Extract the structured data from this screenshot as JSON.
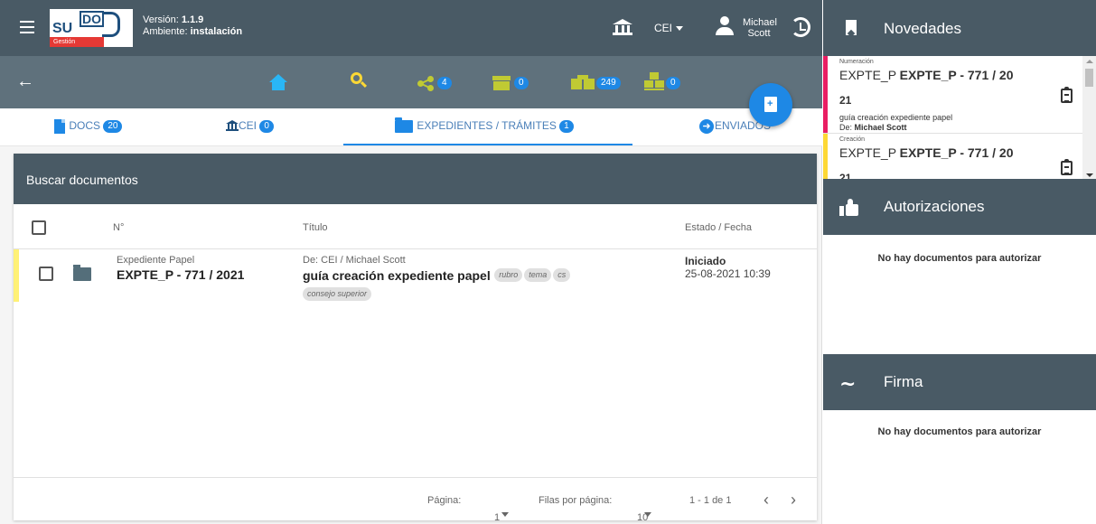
{
  "header": {
    "version_label": "Versión:",
    "version_value": "1.1.9",
    "env_label": "Ambiente:",
    "env_value": "instalación",
    "org_selector": "CEI",
    "user_first": "Michael",
    "user_last": "Scott",
    "logo": {
      "text_su": "SU",
      "text_do": "DO",
      "text_gestion": "Gestión"
    }
  },
  "toolbar": {
    "share_count": "4",
    "archive_count": "0",
    "boxes_count": "249",
    "pallet_count": "0"
  },
  "tabs": [
    {
      "label": "DOCS",
      "count": "20"
    },
    {
      "label": "CEI",
      "count": "0"
    },
    {
      "label": "EXPEDIENTES / TRÁMITES",
      "count": "1"
    },
    {
      "label": "ENVIADOS"
    }
  ],
  "search": {
    "title": "Buscar documentos"
  },
  "table": {
    "columns": [
      "N°",
      "Título",
      "Estado / Fecha"
    ],
    "rows": [
      {
        "type": "Expediente Papel",
        "number": "EXPTE_P - 771 / 2021",
        "from": "De: CEI / Michael Scott",
        "title": "guía creación expediente papel",
        "tags": [
          "rubro",
          "tema",
          "cs",
          "consejo superior"
        ],
        "status": "Iniciado",
        "date": "25-08-2021 10:39"
      }
    ]
  },
  "pager": {
    "page_label": "Página:",
    "page_value": "1",
    "rows_label": "Filas por página:",
    "rows_value": "10",
    "range": "1 - 1 de 1",
    "prev": "‹",
    "next": "›"
  },
  "novedades": {
    "title": "Novedades",
    "items": [
      {
        "kind": "Numeración",
        "prefix": "EXPTE_P",
        "number_line1": "EXPTE_P - 771 / 20",
        "number_line2": "21",
        "desc": "guía creación expediente papel",
        "from_label": "De:",
        "from_value": "Michael Scott",
        "color": "#e91e63"
      },
      {
        "kind": "Creación",
        "prefix": "EXPTE_P",
        "number_line1": "EXPTE_P - 771 / 20",
        "number_line2": "21",
        "color": "#fdd835"
      }
    ]
  },
  "autorizaciones": {
    "title": "Autorizaciones",
    "empty": "No hay documentos para autorizar"
  },
  "firma": {
    "title": "Firma",
    "empty": "No hay documentos para autorizar"
  },
  "colors": {
    "header": "#495a65",
    "toolbar": "#5f717c",
    "accent": "#1e88e5",
    "icon_yellow": "#c0ca33"
  },
  "icons": [
    "menu-icon",
    "bank-icon",
    "user-icon",
    "history-icon",
    "back-arrow-icon",
    "home-icon",
    "search-icon",
    "share-icon",
    "archive-icon",
    "boxes-icon",
    "pallet-icon",
    "new-document-icon",
    "bookmark-icon",
    "thumbs-up-icon",
    "signature-icon",
    "clipboard-icon",
    "folder-icon"
  ]
}
